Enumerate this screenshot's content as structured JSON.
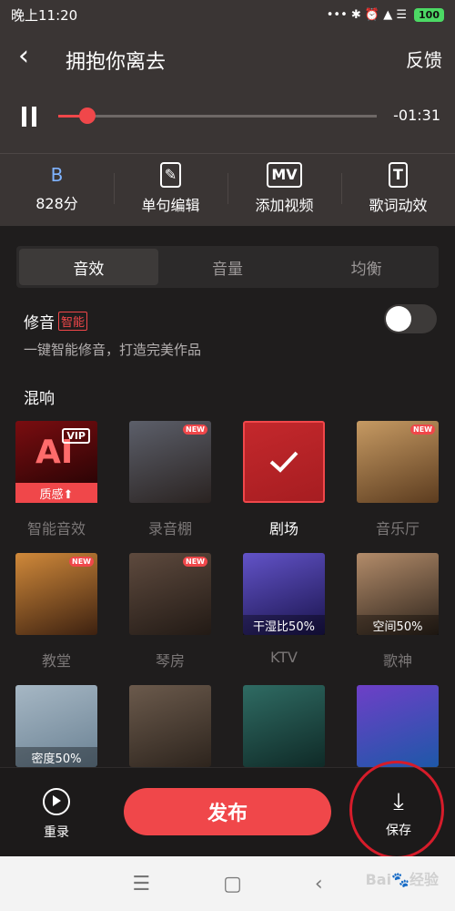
{
  "status_bar": {
    "time": "晚上11:20",
    "icons": "••• ✱ ⏰ ▲ ☰",
    "battery": "100"
  },
  "header": {
    "title": "拥抱你离去",
    "feedback": "反馈",
    "time_remaining": "-01:31",
    "progress": 0.09
  },
  "tools": [
    {
      "icon": "B",
      "label": "828分"
    },
    {
      "icon": "✎",
      "label": "单句编辑"
    },
    {
      "icon": "MV",
      "label": "添加视频"
    },
    {
      "icon": "T",
      "label": "歌词动效"
    }
  ],
  "tabs": [
    "音效",
    "音量",
    "均衡"
  ],
  "tune": {
    "title": "修音",
    "badge": "智能",
    "description": "一键智能修音，打造完美作品",
    "enabled": false
  },
  "reverb": {
    "title": "混响"
  },
  "effects": [
    {
      "label": "智能音效",
      "tag": "质感⬆",
      "badge": "VIP",
      "colors": [
        "#7a0d10",
        "#1c0203"
      ]
    },
    {
      "label": "录音棚",
      "badge": "NEW",
      "colors": [
        "#5c5f6a",
        "#2a2321"
      ]
    },
    {
      "label": "剧场",
      "selected": true,
      "colors": [
        "#c4282c",
        "#a61d21"
      ]
    },
    {
      "label": "音乐厅",
      "badge": "NEW",
      "colors": [
        "#c69a63",
        "#5c3c1f"
      ]
    },
    {
      "label": "教堂",
      "badge": "NEW",
      "colors": [
        "#d0893a",
        "#3d2110"
      ]
    },
    {
      "label": "琴房",
      "badge": "NEW",
      "colors": [
        "#5e4a3e",
        "#221a15"
      ]
    },
    {
      "label": "KTV",
      "tag": "干湿比50%",
      "colors": [
        "#6253c8",
        "#1a144d"
      ]
    },
    {
      "label": "歌神",
      "tag": "空间50%",
      "colors": [
        "#b38c6a",
        "#2d231b"
      ]
    },
    {
      "label": "",
      "tag": "密度50%",
      "colors": [
        "#a6b7c4",
        "#6b8294"
      ]
    },
    {
      "label": "",
      "colors": [
        "#6b5a4c",
        "#2d241d"
      ]
    },
    {
      "label": "",
      "colors": [
        "#2f6b63",
        "#0f2a27"
      ]
    },
    {
      "label": "",
      "colors": [
        "#6e3fc7",
        "#1e58a8"
      ]
    }
  ],
  "bottom": {
    "rerecord": "重录",
    "publish": "发布",
    "save": "保存"
  },
  "navbar": {
    "menu": "☰",
    "home": "▢",
    "back": "‹"
  },
  "watermark": "Bai🐾经验"
}
